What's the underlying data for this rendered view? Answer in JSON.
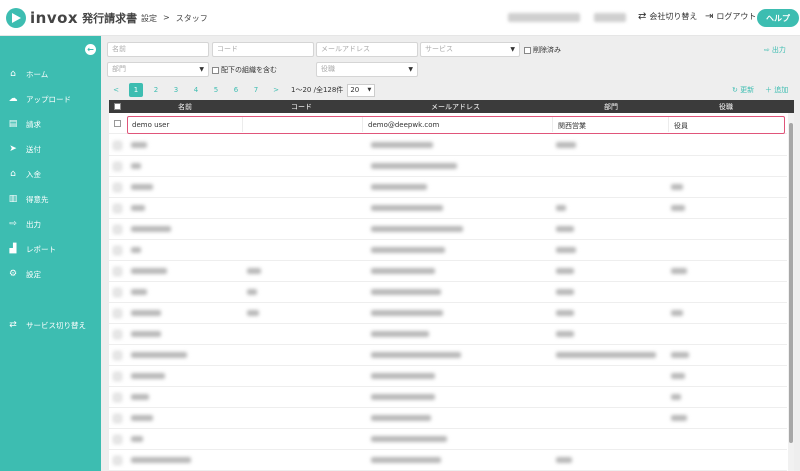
{
  "app": {
    "logo_text": "invox",
    "logo_sub": "発行請求書"
  },
  "breadcrumb": {
    "parent": "設定",
    "sep": ">",
    "current": "スタッフ"
  },
  "header": {
    "switch_company": "会社切り替え",
    "logout": "ログアウト",
    "help": "ヘルプ"
  },
  "sidebar": {
    "collapse_icon": "arrow-left-icon",
    "items": [
      {
        "label": "ホーム",
        "icon": "home-icon"
      },
      {
        "label": "アップロード",
        "icon": "cloud-upload-icon"
      },
      {
        "label": "請求",
        "icon": "document-icon"
      },
      {
        "label": "送付",
        "icon": "send-icon"
      },
      {
        "label": "入金",
        "icon": "bank-icon"
      },
      {
        "label": "得意先",
        "icon": "building-icon"
      },
      {
        "label": "出力",
        "icon": "export-icon"
      },
      {
        "label": "レポート",
        "icon": "chart-icon"
      },
      {
        "label": "設定",
        "icon": "gear-icon"
      },
      {
        "label": "サービス切り替え",
        "icon": "switch-icon"
      }
    ]
  },
  "filters": {
    "name_placeholder": "名前",
    "code_placeholder": "コード",
    "email_placeholder": "メールアドレス",
    "service_placeholder": "サービス",
    "deleted_label": "削除済み",
    "department_placeholder": "部門",
    "include_sub_label": "配下の組織を含む",
    "role_placeholder": "役職",
    "export_label": "出力"
  },
  "pager": {
    "pages": [
      "1",
      "2",
      "3",
      "4",
      "5",
      "6",
      "7"
    ],
    "active": "1",
    "next": ">",
    "prev": "<",
    "info": "1〜20 /全128件",
    "per_page": "20",
    "refresh_label": "更新",
    "add_label": "追加"
  },
  "table": {
    "columns": [
      "名前",
      "コード",
      "メールアドレス",
      "部門",
      "役職"
    ],
    "first_row": {
      "name": "demo user",
      "code": "",
      "email": "demo@deepwk.com",
      "department": "関西営業",
      "role": "役員"
    }
  },
  "colors": {
    "accent": "#3dbdb1",
    "highlight": "#e0557a",
    "table_header": "#3b3b3b"
  }
}
